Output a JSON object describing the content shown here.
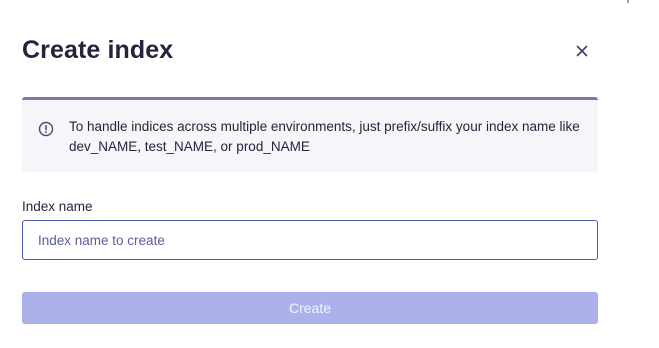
{
  "dialog": {
    "title": "Create index",
    "close_icon": "close-icon"
  },
  "info": {
    "icon": "info-circle-icon",
    "message": "To handle indices across multiple environments, just prefix/suffix your index name like dev_NAME, test_NAME, or prod_NAME"
  },
  "form": {
    "label": "Index name",
    "value": "",
    "placeholder": "Index name to create",
    "submit_label": "Create",
    "submit_disabled": true
  },
  "colors": {
    "title_text": "#23263b",
    "info_border": "#777aaf",
    "info_background": "#f5f5fa",
    "input_border": "#4c5aa6",
    "button_disabled_bg": "#acb1ec"
  }
}
